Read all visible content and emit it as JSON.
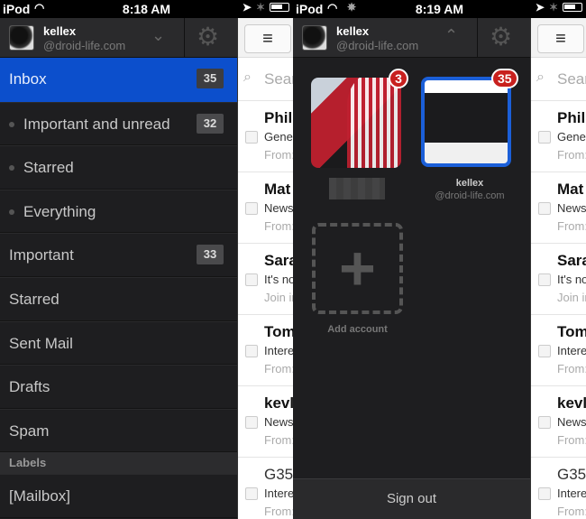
{
  "left": {
    "status": {
      "carrier": "iPod",
      "time": "8:18 AM"
    },
    "account": {
      "name": "kellex",
      "domain": "@droid-life.com"
    },
    "nav": [
      {
        "label": "Inbox",
        "count": "35",
        "active": true
      },
      {
        "label": "Important and unread",
        "count": "32",
        "sub": true
      },
      {
        "label": "Starred",
        "sub": true
      },
      {
        "label": "Everything",
        "sub": true
      },
      {
        "label": "Important",
        "count": "33"
      },
      {
        "label": "Starred"
      },
      {
        "label": "Sent Mail"
      },
      {
        "label": "Drafts"
      },
      {
        "label": "Spam"
      }
    ],
    "labels_header": "Labels",
    "labels": [
      {
        "label": "[Mailbox]"
      }
    ]
  },
  "right": {
    "status": {
      "carrier": "iPod",
      "time": "8:19 AM"
    },
    "account": {
      "name": "kellex",
      "domain": "@droid-life.com"
    },
    "accounts": [
      {
        "badge": "3"
      },
      {
        "badge": "35",
        "name": "kellex",
        "domain": "@droid-life.com",
        "selected": true
      }
    ],
    "add_account": "Add account",
    "sign_out": "Sign out"
  },
  "mail": {
    "search_placeholder": "Sear",
    "rows": [
      {
        "sender": "Phil",
        "subject": "Gene",
        "preview": "From:"
      },
      {
        "sender": "Mat",
        "subject": "News",
        "preview": "From:"
      },
      {
        "sender": "Sara",
        "subject": "It's no",
        "preview": "Join in"
      },
      {
        "sender": "Tom",
        "subject": "Intere",
        "preview": "From:"
      },
      {
        "sender": "kevl",
        "subject": "News",
        "preview": "From:"
      },
      {
        "sender": "G35",
        "subject": "Intere",
        "preview": "From:",
        "read": true
      }
    ]
  },
  "colors": {
    "accent": "#0c4fcc",
    "badge": "#c8201e"
  }
}
